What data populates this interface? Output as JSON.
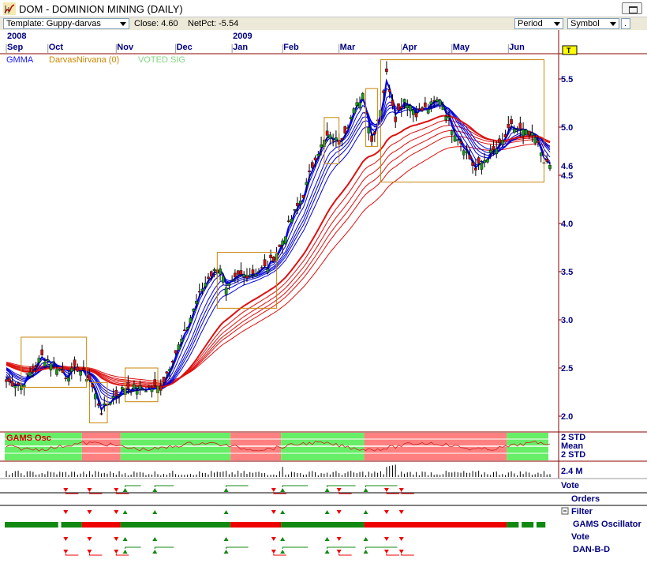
{
  "window": {
    "title": "DOM - DOMINION MINING (DAILY)"
  },
  "toolbar": {
    "template_label": "Template: Guppy-darvas",
    "close_label": "Close: 4.60",
    "netpct_label": "NetPct: -5.54",
    "period_label": "Period",
    "symbol_label": "Symbol",
    "dot_label": "."
  },
  "chart_data": {
    "type": "candlestick",
    "title": "DOM - DOMINION MINING (DAILY)",
    "years": [
      {
        "label": "2008",
        "at_month": "Sep"
      },
      {
        "label": "2009",
        "at_month": "Jan"
      }
    ],
    "months": [
      "Sep",
      "Oct",
      "Nov",
      "Dec",
      "Jan",
      "Feb",
      "Mar",
      "Apr",
      "May",
      "Jun"
    ],
    "price_ticks": [
      "5.5",
      "5.0",
      "4.5",
      "4.0",
      "3.5",
      "3.0",
      "2.5",
      "2.0"
    ],
    "ylim": [
      1.85,
      5.75
    ],
    "last_price": "4.6",
    "legend": [
      {
        "name": "GMMA",
        "color": "#1a1aff"
      },
      {
        "name": "DarvasNirvana (0)",
        "color": "#cc8800"
      },
      {
        "name": "VOTED SIG",
        "color": "#7fd87f"
      }
    ],
    "price_path": [
      {
        "i": 0,
        "p": 2.36
      },
      {
        "i": 5,
        "p": 2.32
      },
      {
        "i": 8,
        "p": 2.45
      },
      {
        "i": 12,
        "p": 2.62
      },
      {
        "i": 16,
        "p": 2.55
      },
      {
        "i": 20,
        "p": 2.42
      },
      {
        "i": 24,
        "p": 2.5
      },
      {
        "i": 28,
        "p": 2.38
      },
      {
        "i": 32,
        "p": 2.05
      },
      {
        "i": 36,
        "p": 2.2
      },
      {
        "i": 40,
        "p": 2.3
      },
      {
        "i": 46,
        "p": 2.28
      },
      {
        "i": 52,
        "p": 2.3
      },
      {
        "i": 56,
        "p": 2.6
      },
      {
        "i": 60,
        "p": 2.85
      },
      {
        "i": 64,
        "p": 3.2
      },
      {
        "i": 68,
        "p": 3.45
      },
      {
        "i": 72,
        "p": 3.55
      },
      {
        "i": 74,
        "p": 3.3
      },
      {
        "i": 78,
        "p": 3.45
      },
      {
        "i": 84,
        "p": 3.5
      },
      {
        "i": 88,
        "p": 3.55
      },
      {
        "i": 92,
        "p": 3.75
      },
      {
        "i": 96,
        "p": 4.05
      },
      {
        "i": 100,
        "p": 4.3
      },
      {
        "i": 104,
        "p": 4.7
      },
      {
        "i": 108,
        "p": 4.9
      },
      {
        "i": 112,
        "p": 4.85
      },
      {
        "i": 116,
        "p": 5.1
      },
      {
        "i": 120,
        "p": 5.35
      },
      {
        "i": 123,
        "p": 4.85
      },
      {
        "i": 126,
        "p": 5.2
      },
      {
        "i": 128,
        "p": 5.55
      },
      {
        "i": 131,
        "p": 5.1
      },
      {
        "i": 134,
        "p": 5.3
      },
      {
        "i": 138,
        "p": 5.15
      },
      {
        "i": 142,
        "p": 5.2
      },
      {
        "i": 146,
        "p": 5.3
      },
      {
        "i": 150,
        "p": 5.0
      },
      {
        "i": 154,
        "p": 4.8
      },
      {
        "i": 158,
        "p": 4.55
      },
      {
        "i": 162,
        "p": 4.7
      },
      {
        "i": 166,
        "p": 4.8
      },
      {
        "i": 170,
        "p": 5.0
      },
      {
        "i": 174,
        "p": 4.95
      },
      {
        "i": 178,
        "p": 4.88
      },
      {
        "i": 182,
        "p": 4.6
      }
    ],
    "darvas_boxes": [
      {
        "i0": 5,
        "i1": 27,
        "lo": 2.3,
        "hi": 2.82
      },
      {
        "i0": 28,
        "i1": 34,
        "lo": 1.93,
        "hi": 2.35
      },
      {
        "i0": 40,
        "i1": 51,
        "lo": 2.15,
        "hi": 2.5
      },
      {
        "i0": 71,
        "i1": 91,
        "lo": 3.12,
        "hi": 3.7
      },
      {
        "i0": 107,
        "i1": 112,
        "lo": 4.62,
        "hi": 5.1
      },
      {
        "i0": 121,
        "i1": 125,
        "lo": 4.8,
        "hi": 5.4
      },
      {
        "i0": 126,
        "i1": 181,
        "lo": 4.43,
        "hi": 5.7
      }
    ],
    "oscillator": {
      "name": "GAMS Osc",
      "labels": [
        "2 STD",
        "Mean",
        "2 STD"
      ],
      "zones": [
        {
          "i0": 0,
          "i1": 26,
          "zone": "green"
        },
        {
          "i0": 26,
          "i1": 39,
          "zone": "red"
        },
        {
          "i0": 39,
          "i1": 76,
          "zone": "green"
        },
        {
          "i0": 76,
          "i1": 93,
          "zone": "red"
        },
        {
          "i0": 93,
          "i1": 121,
          "zone": "green"
        },
        {
          "i0": 121,
          "i1": 169,
          "zone": "red"
        },
        {
          "i0": 169,
          "i1": 183,
          "zone": "green"
        }
      ]
    },
    "volume_label": "2.4 M",
    "signal_panel": {
      "labels": [
        "Vote",
        "Orders",
        "Filter",
        "GAMS Oscillator",
        "Vote",
        "DAN-B-D"
      ],
      "filter_bar": [
        {
          "i0": 0,
          "i1": 18,
          "state": "green"
        },
        {
          "i0": 19,
          "i1": 26,
          "state": "green"
        },
        {
          "i0": 26,
          "i1": 39,
          "state": "red"
        },
        {
          "i0": 39,
          "i1": 76,
          "state": "green"
        },
        {
          "i0": 76,
          "i1": 93,
          "state": "red"
        },
        {
          "i0": 93,
          "i1": 121,
          "state": "green"
        },
        {
          "i0": 121,
          "i1": 169,
          "state": "red"
        },
        {
          "i0": 169,
          "i1": 173,
          "state": "green"
        },
        {
          "i0": 174,
          "i1": 178,
          "state": "green"
        },
        {
          "i0": 179,
          "i1": 182,
          "state": "green"
        }
      ]
    },
    "colors": {
      "up_candle": "#1a9a1a",
      "down_candle": "#cc1111",
      "gmma_short": "#0000dd",
      "gmma_long": "#dd1111",
      "darvas_box": "#c8860a",
      "osc_green": "#66ee66",
      "osc_red": "#ff8080"
    }
  }
}
